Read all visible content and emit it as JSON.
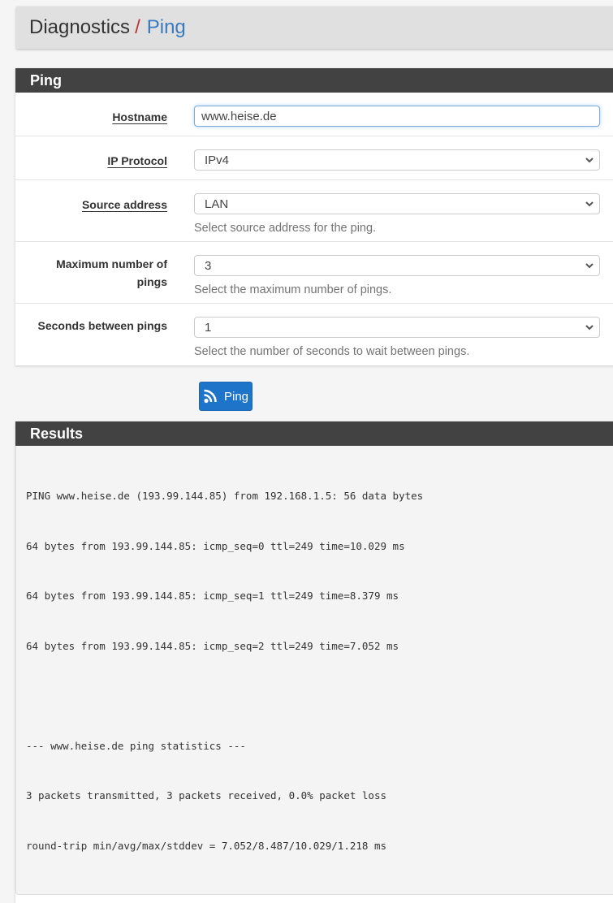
{
  "breadcrumb": {
    "parent": "Diagnostics",
    "separator": "/",
    "current": "Ping"
  },
  "ping_panel": {
    "title": "Ping",
    "fields": [
      {
        "label": "Hostname",
        "value": "www.heise.de",
        "help": ""
      },
      {
        "label": "IP Protocol",
        "value": "IPv4",
        "help": ""
      },
      {
        "label": "Source address",
        "value": "LAN",
        "help": "Select source address for the ping."
      },
      {
        "label_line1": "Maximum number of",
        "label_line2": "pings",
        "value": "3",
        "help": "Select the maximum number of pings."
      },
      {
        "label": "Seconds between pings",
        "value": "1",
        "help": "Select the number of seconds to wait between pings."
      }
    ]
  },
  "ping_button": {
    "label": "Ping",
    "icon": "rss-icon"
  },
  "results_panel": {
    "title": "Results",
    "output": [
      "PING www.heise.de (193.99.144.85) from 192.168.1.5: 56 data bytes",
      "64 bytes from 193.99.144.85: icmp_seq=0 ttl=249 time=10.029 ms",
      "64 bytes from 193.99.144.85: icmp_seq=1 ttl=249 time=8.379 ms",
      "64 bytes from 193.99.144.85: icmp_seq=2 ttl=249 time=7.052 ms",
      "",
      "--- www.heise.de ping statistics ---",
      "3 packets transmitted, 3 packets received, 0.0% packet loss",
      "round-trip min/avg/max/stddev = 7.052/8.487/10.029/1.218 ms"
    ]
  },
  "colors": {
    "panel_heading": "#424242",
    "button": "#1e74c9",
    "breadcrumb_current": "#3a7bbf",
    "breadcrumb_separator": "#bb3333"
  }
}
